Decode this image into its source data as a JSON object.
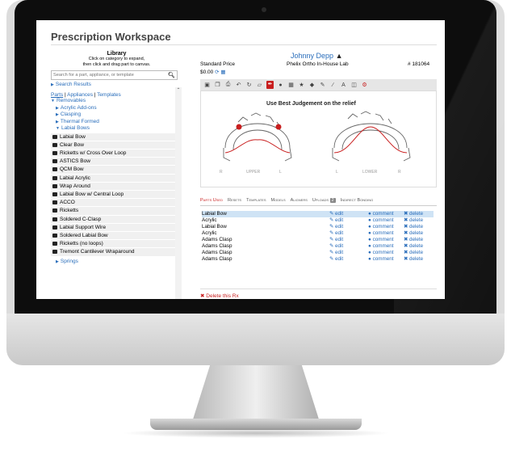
{
  "workspace": {
    "title": "Prescription Workspace"
  },
  "library": {
    "title": "Library",
    "subtitle_line1": "Click on category to expand,",
    "subtitle_line2": "then click and drag part to canvas.",
    "search_placeholder": "Search for a part, appliance, or template",
    "search_results": "Search Results",
    "tabs": [
      "Parts",
      "Appliances",
      "Templates"
    ],
    "tab_sep": "|",
    "categories": {
      "removables": "Removables",
      "acrylic_addons": "Acrylic Add-ons",
      "clasping": "Clasping",
      "thermal_formed": "Thermal Formed",
      "labial_bows": "Labial Bows",
      "springs": "Springs"
    },
    "items": [
      "Labial Bow",
      "Clear Bow",
      "Ricketts w/ Cross Over Loop",
      "ASTICS Bow",
      "QCM Bow",
      "Labial Acrylic",
      "Wrap Around",
      "Labial Bow w/ Central Loop",
      "ACCO",
      "Ricketts",
      "Soldered C-Clasp",
      "Labial Support Wire",
      "Soldered Labial Bow",
      "Ricketts (no loops)",
      "Tremont Cantilever Wraparound"
    ]
  },
  "patient": {
    "name": "Johnny Depp",
    "price_label": "Standard Price",
    "price": "$0.00",
    "lab": "Phelix Ortho In-House Lab",
    "number": "# 181064"
  },
  "canvas": {
    "note": "Use Best Judgement on the relief",
    "upper": {
      "left": "R",
      "mid": "UPPER",
      "right": "L"
    },
    "lower": {
      "left": "L",
      "mid": "LOWER",
      "right": "R"
    }
  },
  "tabs": {
    "items": [
      "Parts Used",
      "Resets",
      "Templates",
      "Models",
      "Aligners",
      "Uploads",
      "Indirect Bonding"
    ],
    "uploads_count": "2"
  },
  "parts": {
    "actions": {
      "edit": "edit",
      "comment": "comment",
      "delete": "delete"
    },
    "rows": [
      "Labial Bow",
      "Acrylic",
      "Labial Bow",
      "Acrylic",
      "Adams Clasp",
      "Adams Clasp",
      "Adams Clasp",
      "Adams Clasp"
    ]
  },
  "delete_rx": "Delete this Rx",
  "colors": {
    "accent": "#2a6ebb",
    "danger": "#c81e1e",
    "selected_row": "#cfe3f5"
  }
}
